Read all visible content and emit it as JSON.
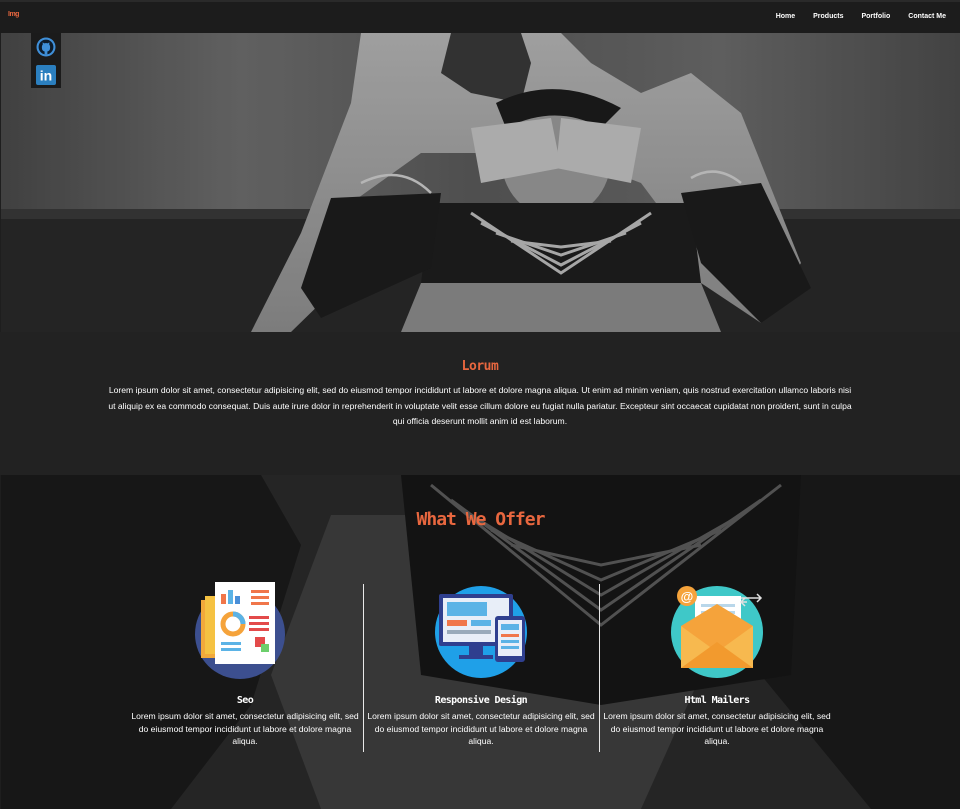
{
  "brand": {
    "label": "Img"
  },
  "nav": {
    "items": [
      "Home",
      "Products",
      "Portfolio",
      "Contact Me"
    ]
  },
  "social": {
    "github_icon": "github-icon",
    "linkedin_icon": "linkedin-icon",
    "linkedin_text": "in"
  },
  "hero": {
    "image": "tattooed-couple-photo"
  },
  "intro": {
    "title": "Lorum",
    "text": "Lorem ipsum dolor sit amet, consectetur adipisicing elit, sed do eiusmod tempor incididunt ut labore et dolore magna aliqua. Ut enim ad minim veniam, quis nostrud exercitation ullamco laboris nisi ut aliquip ex ea commodo consequat. Duis aute irure dolor in reprehenderit in voluptate velit esse cillum dolore eu fugiat nulla pariatur. Excepteur sint occaecat cupidatat non proident, sunt in culpa qui officia deserunt mollit anim id est laborum."
  },
  "offer": {
    "title": "What We Offer",
    "cards": [
      {
        "title": "Seo",
        "icon": "seo-report-icon",
        "text": "Lorem ipsum dolor sit amet, consectetur adipisicing elit, sed do eiusmod tempor incididunt ut labore et dolore magna aliqua."
      },
      {
        "title": "Responsive Design",
        "icon": "responsive-devices-icon",
        "text": "Lorem ipsum dolor sit amet, consectetur adipisicing elit, sed do eiusmod tempor incididunt ut labore et dolore magna aliqua."
      },
      {
        "title": "Html Mailers",
        "icon": "email-envelope-icon",
        "text": "Lorem ipsum dolor sit amet, consectetur adipisicing elit, sed do eiusmod tempor incididunt ut labore et dolore magna aliqua."
      }
    ]
  },
  "colors": {
    "accent": "#e8673f",
    "background": "#222222"
  }
}
